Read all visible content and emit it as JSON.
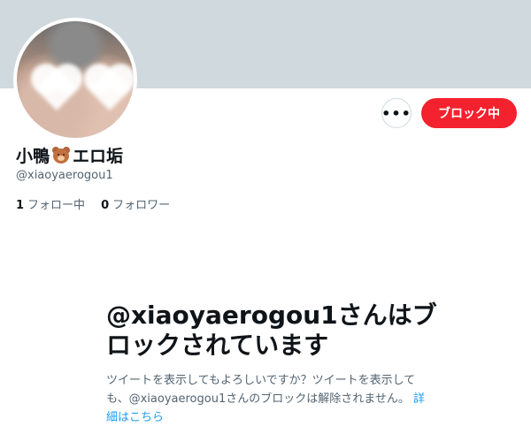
{
  "profile": {
    "name_before": "小鴨",
    "name_after": "エロ垢",
    "name_emoji": "bear-face-icon",
    "handle": "@xiaoyaerogou1",
    "following_count": "1",
    "following_label": "フォロー中",
    "followers_count": "0",
    "followers_label": "フォロワー"
  },
  "actions": {
    "more_label": "•••",
    "block_label": "ブロック中"
  },
  "blocked_notice": {
    "title": "@xiaoyaerogou1さんはブロックされています",
    "description": "ツイートを表示してもよろしいですか？ツイートを表示しても、@xiaoyaerogou1さんのブロックは解除されません。",
    "learn_more": "詳細はこちら"
  },
  "colors": {
    "banner": "#cfd9de",
    "block_button": "#f4212e",
    "link": "#1d9bf0",
    "secondary_text": "#536471"
  }
}
